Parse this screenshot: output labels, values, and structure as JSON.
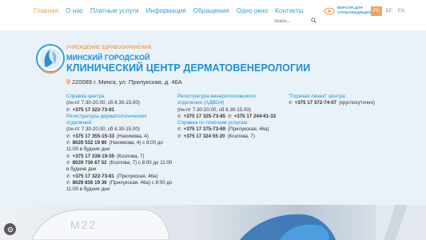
{
  "nav": {
    "items": [
      {
        "label": "Главная",
        "active": true
      },
      {
        "label": "О нас"
      },
      {
        "label": "Платные услуги"
      },
      {
        "label": "Информация"
      },
      {
        "label": "Обращения"
      },
      {
        "label": "Одно окно"
      },
      {
        "label": "Контакты"
      }
    ]
  },
  "search": {
    "placeholder": "поиск..."
  },
  "visually_impaired": {
    "label": "ВЕРСИЯ ДЛЯ СЛАБОВИДЯЩИХ"
  },
  "languages": [
    {
      "code": "РУ",
      "active": true
    },
    {
      "code": "БЕ"
    },
    {
      "code": "EN"
    }
  ],
  "org": {
    "small": "УЧРЕЖДЕНИЕ ЗДРАВООХРАНЕНИЯ",
    "line1": "МИНСКИЙ ГОРОДСКОЙ",
    "line2": "КЛИНИЧЕСКИЙ ЦЕНТР ДЕРМАТОВЕНЕРОЛОГИИ"
  },
  "address": "220089 г. Минск, ул. Прилукская, д. 46А",
  "contacts": {
    "col1": {
      "info_title": "Справка центра",
      "info_hours": "(пн-пт 7.30-20.00, сб 8.30-15.00)",
      "info_phone": "+375 17 322-73-81",
      "reg_title_1": "Регистратуры дерматологических",
      "reg_title_2": "отделений:",
      "reg_hours": "(пн-пт 7.30-20.00, сб 8.30-15.00)",
      "phones": [
        {
          "phone": "+375 17 355-15-33",
          "note": "(Нахимова, 4)"
        },
        {
          "phone": "8029 532 19 80",
          "note": "(Нахимова, 4) с 8:00 до",
          "note2": "11:00 в будние дни"
        },
        {
          "phone": "+375 17 338-19-55",
          "note": "(Козлова, 7)"
        },
        {
          "phone": "8029 736 67 52",
          "note": "(Козлова, 7) с 8:00 до 11:00",
          "note2": "в будние дни"
        },
        {
          "phone": "+375 17 322-73-81",
          "note": "(Прилукская, 46а)"
        },
        {
          "phone": "8029 836 19 36",
          "note": "(Прилукская, 46а) с 8:00 до",
          "note2": "11:00 в будние дни"
        }
      ]
    },
    "col2": {
      "ven_title_1": "Регистратура венерологического",
      "ven_title_2": "отделения (АДВО4)",
      "ven_hours": "(пн-пт 7.30-20.00, сб 8.30-15.00)",
      "ven_phone_1": "+375 17 325-73-85",
      "ven_phone_2": "+375 17 244-61-32",
      "paid_title": "Справка по платным услугам",
      "paid_phone_1": "+375 17 375-73-69",
      "paid_note_1": "(Прилукская, 46а)",
      "paid_phone_2": "+375 17 324 55 20",
      "paid_note_2": "(Козлова, 7)"
    },
    "col3": {
      "hotline_title": "\"Горячая линия\" центра:",
      "hotline_phone": "+375 17 372-74-07",
      "hotline_note": "(круглосуточно)"
    }
  },
  "colors": {
    "accent": "#f0a35e",
    "link": "#1f8fd1",
    "panel": "#eaf2f9"
  }
}
